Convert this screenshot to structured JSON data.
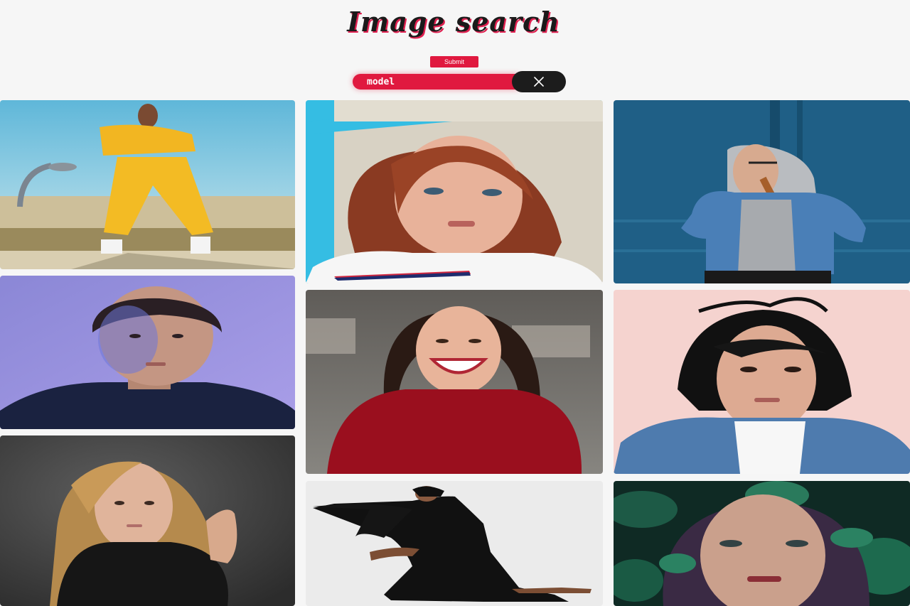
{
  "header": {
    "title": "Image search",
    "submit_label": "Submit"
  },
  "search": {
    "value": "model"
  },
  "icons": {
    "clear": "close-icon"
  },
  "colors": {
    "accent": "#e0193f",
    "dark": "#1c1c1c",
    "background": "#f6f6f6"
  },
  "results": {
    "photos": [
      "photo-yellow-tracksuit-beach",
      "photo-red-hair-white-tee",
      "photo-grey-hoodie-denim-blue-wall",
      "photo-blue-light-portrait",
      "photo-smiling-red-top",
      "photo-dark-hair-denim-pink-wall",
      "photo-blonde-dark-background",
      "photo-black-dress-dancer",
      "photo-leaves-portrait"
    ]
  }
}
